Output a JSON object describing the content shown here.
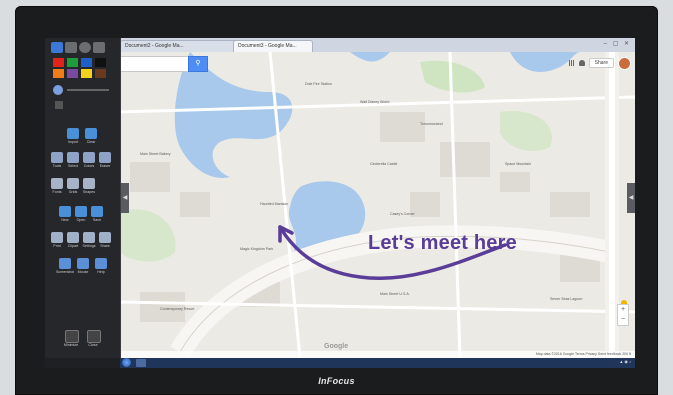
{
  "device": {
    "brand": "InFocus"
  },
  "browser": {
    "tabs": [
      {
        "label": "Document2 - Google Ma..."
      },
      {
        "label": "Document3 - Google Ma..."
      }
    ]
  },
  "map": {
    "search_placeholder": "",
    "top_bar": {
      "share_label": "Share"
    },
    "annotation_text": "Let's meet here",
    "annotation_color": "#5a3d98",
    "google_label": "Google",
    "footer_text": "Map data ©2016 Google  Terms  Privacy  Send feedback  200 ft"
  },
  "toolbar": {
    "colors": [
      "#e2231a",
      "#1f9d3a",
      "#1f5fc9",
      "#111111",
      "#f07d1a",
      "#7a4aa0",
      "#f2d21a",
      "#6a3a1e"
    ],
    "sections": [
      {
        "buttons": [
          {
            "label": "Import",
            "icon": "import-icon"
          },
          {
            "label": "Clear",
            "icon": "clear-icon"
          }
        ]
      },
      {
        "buttons": [
          {
            "label": "Tools",
            "icon": "pen-icon"
          },
          {
            "label": "Select",
            "icon": "select-icon"
          },
          {
            "label": "Colors",
            "icon": "colors-icon"
          },
          {
            "label": "Eraser",
            "icon": "eraser-icon"
          }
        ]
      },
      {
        "buttons": [
          {
            "label": "Fonts",
            "icon": "fonts-icon"
          },
          {
            "label": "Grids",
            "icon": "grids-icon"
          },
          {
            "label": "Shapes",
            "icon": "shapes-icon"
          }
        ]
      },
      {
        "buttons": [
          {
            "label": "New",
            "icon": "new-icon"
          },
          {
            "label": "Open",
            "icon": "open-icon"
          },
          {
            "label": "Save",
            "icon": "save-icon"
          }
        ]
      },
      {
        "buttons": [
          {
            "label": "Print",
            "icon": "print-icon"
          },
          {
            "label": "Clipart",
            "icon": "clipart-icon"
          },
          {
            "label": "Settings",
            "icon": "settings-icon"
          },
          {
            "label": "Share",
            "icon": "share-icon"
          }
        ]
      },
      {
        "buttons": [
          {
            "label": "Screenshot",
            "icon": "screenshot-icon"
          },
          {
            "label": "Mouse",
            "icon": "mouse-icon"
          },
          {
            "label": "Help",
            "icon": "help-icon"
          }
        ]
      }
    ],
    "bottom_buttons": [
      {
        "label": "Minimize",
        "icon": "minimize-icon"
      },
      {
        "label": "Close",
        "icon": "close-icon"
      }
    ]
  },
  "map_labels": [
    "Dole Fire Station",
    "Walt Disney World",
    "Main Street Bakery",
    "Space Mountain",
    "Tomorrowland",
    "Cinderella Castle",
    "Haunted Mansion",
    "Magic Kingdom Park",
    "Contemporary Resort",
    "Seven Seas Lagoon",
    "Casey's Corner",
    "Main Street U.S.A."
  ]
}
